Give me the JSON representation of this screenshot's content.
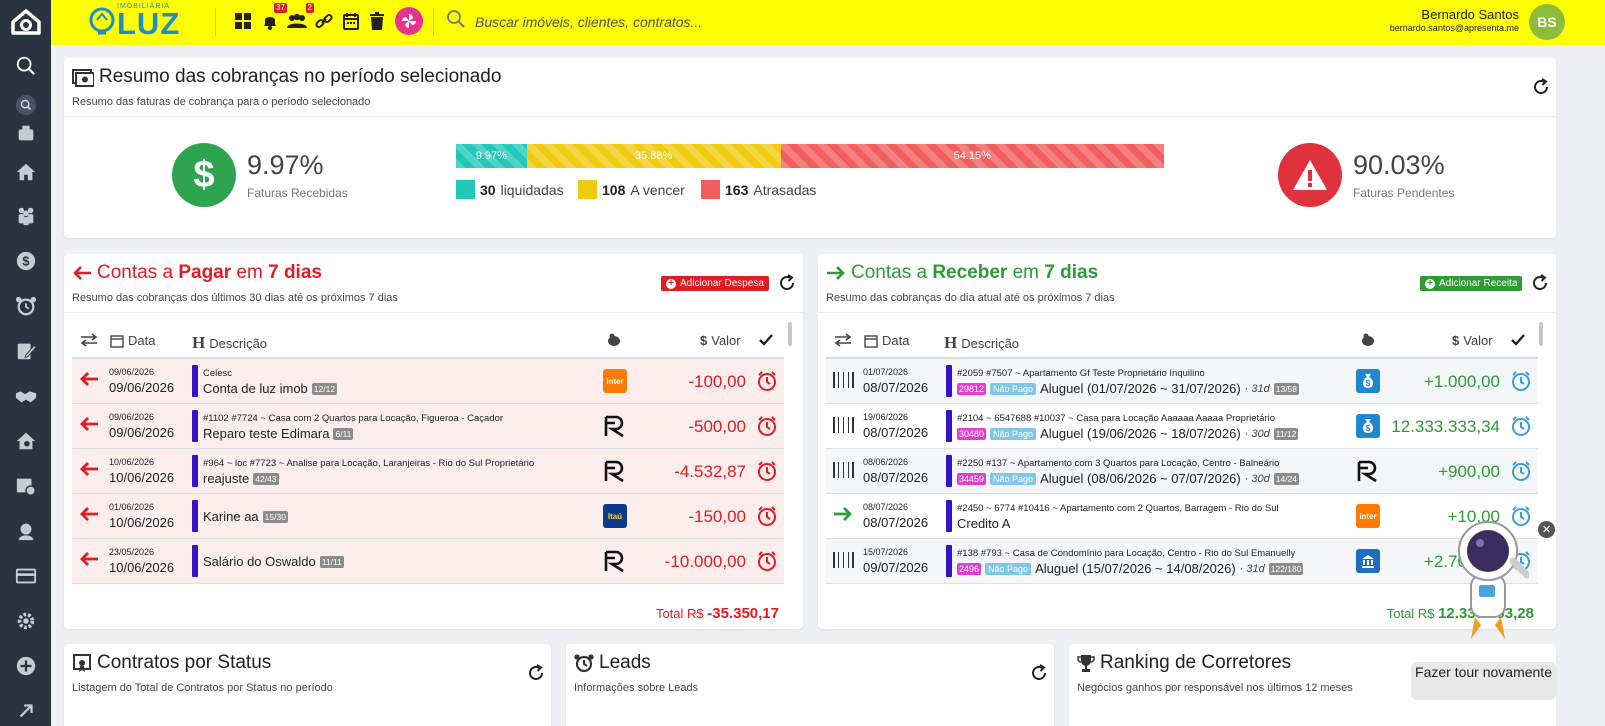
{
  "brand": {
    "name": "LUZ",
    "subtitle": "IMOBILIÁRIA"
  },
  "topbar": {
    "search_placeholder": "Buscar imóveis, clientes, contratos...",
    "badges": {
      "notifications": "37",
      "people": "2"
    },
    "user": {
      "name": "Bernardo Santos",
      "email": "bernardo.santos@apresenta.me",
      "initials": "BS"
    }
  },
  "summary": {
    "title": "Resumo das cobranças no período selecionado",
    "subtitle": "Resumo das faturas de cobrança para o período selecionado",
    "received_pct": "9.97%",
    "received_label": "Faturas Recebidas",
    "pending_pct": "90.03%",
    "pending_label": "Faturas Pendentes",
    "progress": [
      {
        "label": "9.97%",
        "value": 9.97,
        "color": "#1fc8b8"
      },
      {
        "label": "35.88%",
        "value": 35.88,
        "color": "#f0cb0e"
      },
      {
        "label": "54.15%",
        "value": 54.15,
        "color": "#f25d5d"
      }
    ],
    "legend": [
      {
        "count": "30",
        "label": "liquidadas",
        "color": "#1fc8b8"
      },
      {
        "count": "108",
        "label": "A vencer",
        "color": "#f0cb0e"
      },
      {
        "count": "163",
        "label": "Atrasadas",
        "color": "#f25d5d"
      }
    ]
  },
  "pagar": {
    "title_a": "Contas a ",
    "title_b": "Pagar",
    "title_c": " em ",
    "title_d": "7 dias",
    "subtitle": "Resumo das cobranças dos últimos 30 dias até os próximos 7 dias",
    "add_label": "Adicionar Despesa",
    "columns": {
      "data": "Data",
      "descricao": "Descrição",
      "valor": "Valor"
    },
    "rows": [
      {
        "date1": "09/06/2026",
        "date2": "09/06/2026",
        "meta": "Celesc",
        "desc": "Conta de luz imob",
        "tag": "12/12",
        "bank": "inter",
        "value": "-100,00"
      },
      {
        "date1": "09/06/2026",
        "date2": "09/06/2026",
        "meta": "#1102  #7724 ~ Casa com 2 Quartos para Locação, Figueroa - Caçador",
        "desc": "Reparo teste Edimara",
        "tag": "6/11",
        "bank": "r",
        "value": "-500,00"
      },
      {
        "date1": "10/06/2026",
        "date2": "10/06/2026",
        "meta": "#964 ~ loc  #7723 ~ Analise para Locação, Laranjeiras - Rio do Sul  Proprietário",
        "desc": "reajuste",
        "tag": "42/43",
        "bank": "r",
        "value": "-4.532,87"
      },
      {
        "date1": "01/06/2026",
        "date2": "10/06/2026",
        "meta": "",
        "desc": "Karine aa",
        "tag": "15/30",
        "bank": "itau",
        "value": "-150,00"
      },
      {
        "date1": "23/05/2026",
        "date2": "10/06/2026",
        "meta": "",
        "desc": "Salário do Oswaldo",
        "tag": "11/11",
        "bank": "r",
        "value": "-10.000,00"
      }
    ],
    "total_label": "Total R$",
    "total_value": "-35.350,17"
  },
  "receber": {
    "title_a": "Contas a ",
    "title_b": "Receber",
    "title_c": " em ",
    "title_d": "7 dias",
    "subtitle": "Resumo das cobranças do dia atual até os próximos 7 dias",
    "add_label": "Adicionar Receita",
    "columns": {
      "data": "Data",
      "descricao": "Descrição",
      "valor": "Valor"
    },
    "rows": [
      {
        "date1": "01/07/2026",
        "date2": "08/07/2026",
        "meta": "#2059  #7507 ~ Apartamento  Gf Teste  Proprietário  Inquilino",
        "id": "29812",
        "status": "Não Pago",
        "desc": "Aluguel (01/07/2026 ~ 31/07/2026)",
        "period": "· 31d",
        "tag": "13/58",
        "bank": "money",
        "value": "+1.000,00"
      },
      {
        "date1": "19/06/2026",
        "date2": "08/07/2026",
        "meta": "#2104 ~ 6547688  #10037 ~ Casa para Locação  Aaaaaa Aaaaa  Proprietário",
        "id": "30480",
        "status": "Não Pago",
        "desc": "Aluguel (19/06/2026 ~ 18/07/2026)",
        "period": "· 30d",
        "tag": "11/12",
        "bank": "money",
        "value": "12.333.333,34"
      },
      {
        "date1": "08/06/2026",
        "date2": "08/07/2026",
        "meta": "#2250  #137 ~ Apartamento com 3 Quartos para Locação, Centro - Balneário",
        "id": "34459",
        "status": "Não Pago",
        "desc": "Aluguel (08/06/2026 ~ 07/07/2026)",
        "period": "· 30d",
        "tag": "14/24",
        "bank": "r",
        "value": "+900,00"
      },
      {
        "date1": "08/07/2026",
        "date2": "08/07/2026",
        "meta": "#2450 ~ 6774  #10416 ~ Apartamento com 2 Quartos, Barragem - Rio do Sul",
        "id": "",
        "status": "",
        "desc": "Credito A",
        "period": "",
        "tag": "",
        "bank": "inter",
        "value": "+10,00"
      },
      {
        "date1": "15/07/2026",
        "date2": "09/07/2026",
        "meta": "#138  #793 ~ Casa de Condomínio para Locação, Centro - Rio do Sul  Emanuelly",
        "id": "2496",
        "status": "Não Pago",
        "desc": "Aluguel (15/07/2026 ~ 14/08/2026)",
        "period": "· 31d",
        "tag": "122/180",
        "bank": "bank",
        "value": "+2.700,00"
      }
    ],
    "total_label": "Total R$",
    "total_value": "12.338.003,28"
  },
  "contratos": {
    "title": "Contratos por Status",
    "subtitle": "Listagem do Total de Contratos por Status no período"
  },
  "leads": {
    "title": "Leads",
    "subtitle": "Informações sobre Leads"
  },
  "ranking": {
    "title": "Ranking de Corretores",
    "subtitle": "Negócios ganhos por responsável nos últimos 12 meses"
  },
  "tour": {
    "label": "Fazer tour novamente"
  },
  "colors": {
    "yellow": "#ffff00",
    "red": "#e31b23",
    "green": "#2e9b34",
    "sidebar": "#2b3240"
  }
}
